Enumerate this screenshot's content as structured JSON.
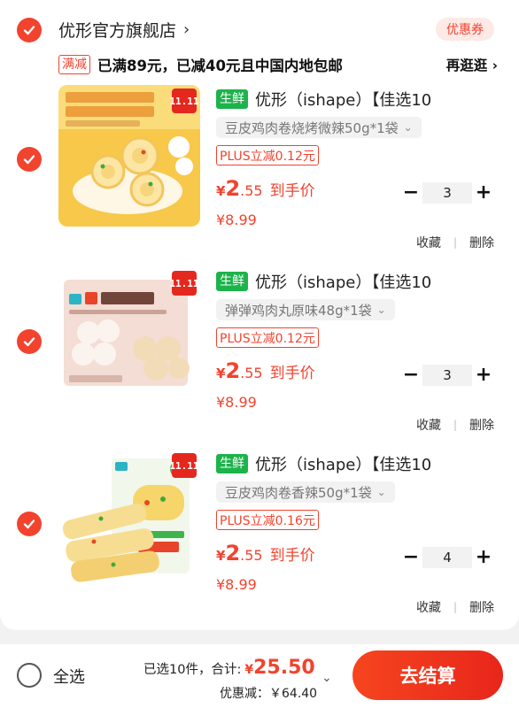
{
  "shop": {
    "name": "优形官方旗舰店",
    "chevron": "›",
    "coupon_label": "优惠券",
    "promo_tag": "满减",
    "promo_text": "已满89元，已减40元且中国内地包邮",
    "promo_link": "再逛逛 ›"
  },
  "items": [
    {
      "badge": "11.11",
      "fresh_tag": "生鲜",
      "title": "优形（ishape）【佳选10",
      "spec": "豆皮鸡肉卷烧烤微辣50g*1袋",
      "plus": "PLUS立减0.12元",
      "price_cur": "¥",
      "price_int": "2",
      "price_dec": ".55",
      "price_label": "到手价",
      "orig_price": "¥8.99",
      "qty": "3",
      "collect": "收藏",
      "delete": "删除"
    },
    {
      "badge": "11.11",
      "fresh_tag": "生鲜",
      "title": "优形（ishape）【佳选10",
      "spec": "弹弹鸡肉丸原味48g*1袋",
      "plus": "PLUS立减0.12元",
      "price_cur": "¥",
      "price_int": "2",
      "price_dec": ".55",
      "price_label": "到手价",
      "orig_price": "¥8.99",
      "qty": "3",
      "collect": "收藏",
      "delete": "删除"
    },
    {
      "badge": "11.11",
      "fresh_tag": "生鲜",
      "title": "优形（ishape）【佳选10",
      "spec": "豆皮鸡肉卷香辣50g*1袋",
      "plus": "PLUS立减0.16元",
      "price_cur": "¥",
      "price_int": "2",
      "price_dec": ".55",
      "price_label": "到手价",
      "orig_price": "¥8.99",
      "qty": "4",
      "collect": "收藏",
      "delete": "删除"
    }
  ],
  "controls": {
    "dropdown_icon": "⌄",
    "minus": "−",
    "plus": "+",
    "separator": "|"
  },
  "bottom": {
    "select_all": "全选",
    "count_text": "已选10件，合计:",
    "total_cur": "¥",
    "total": "25.50",
    "discount": "优惠减：￥64.40",
    "chevron": "⌄",
    "checkout": "去结算"
  },
  "colors": {
    "accent": "#f2432e",
    "fresh": "#1db34b"
  }
}
